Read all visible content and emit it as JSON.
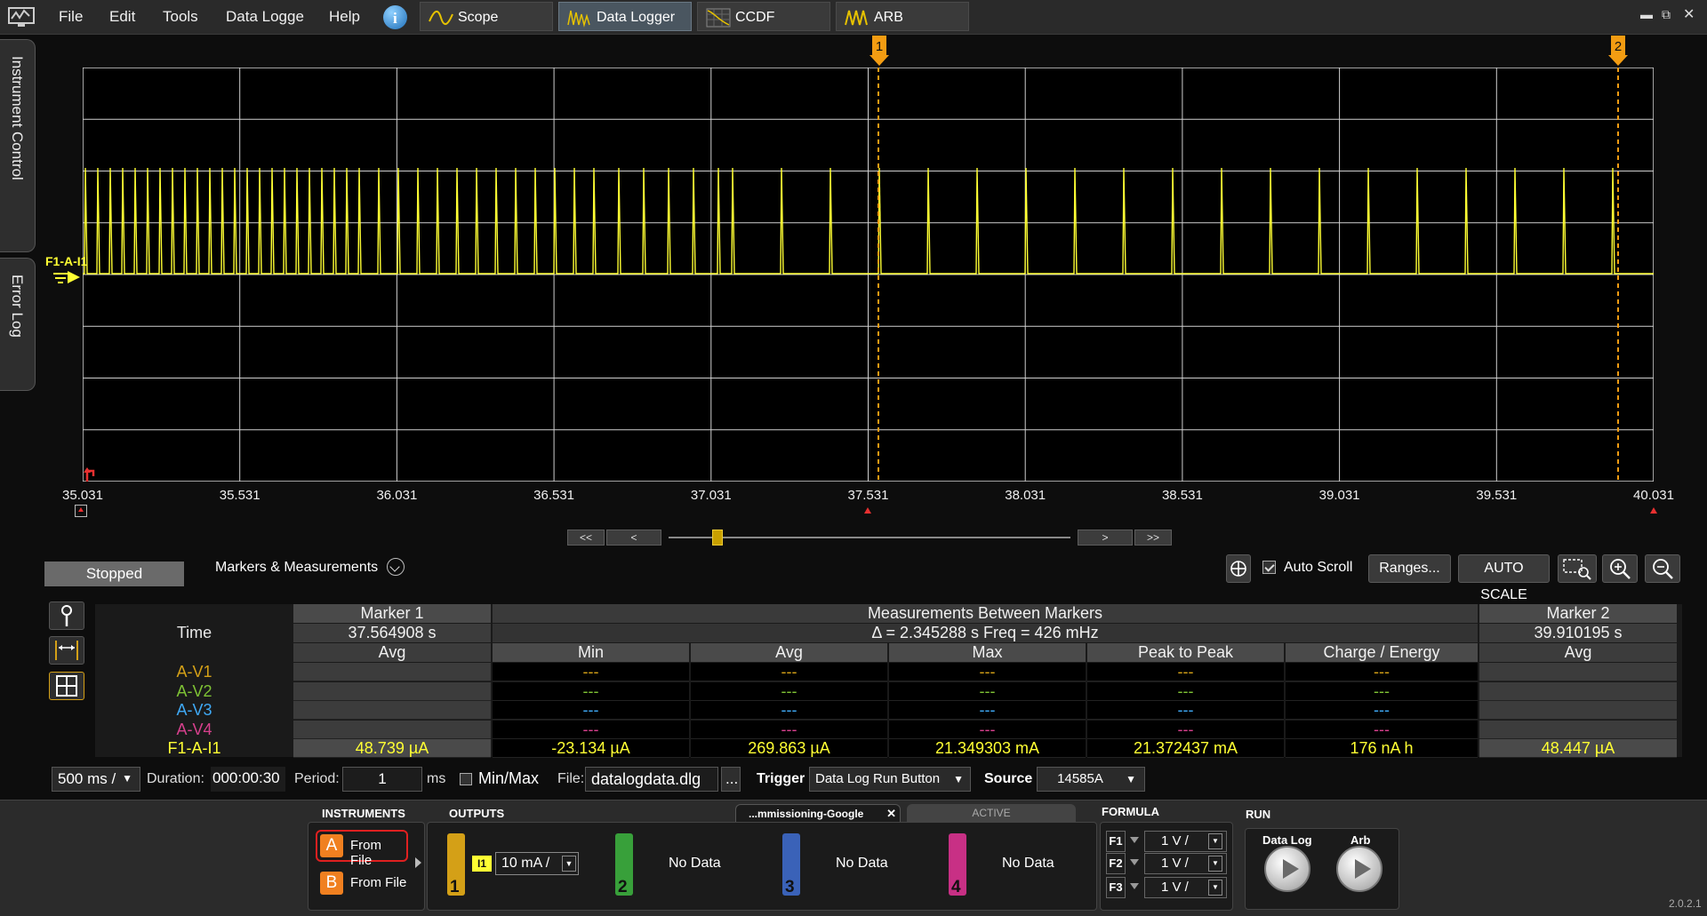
{
  "menu": {
    "file": "File",
    "edit": "Edit",
    "tools": "Tools",
    "data_logger": "Data Logge",
    "help": "Help"
  },
  "tabs": [
    {
      "label": "Scope",
      "active": false
    },
    {
      "label": "Data Logger",
      "active": true
    },
    {
      "label": "CCDF",
      "active": false
    },
    {
      "label": "ARB",
      "active": false
    }
  ],
  "side_tabs": {
    "instrument_control": "Instrument Control",
    "error_log": "Error Log"
  },
  "plot": {
    "trace_label": "F1-A-I1",
    "trace_color": "#ffff33",
    "marker_color": "#f39c12",
    "x_ticks": [
      "35.031",
      "35.531",
      "36.031",
      "36.531",
      "37.031",
      "37.531",
      "38.031",
      "38.531",
      "39.031",
      "39.531",
      "40.031"
    ],
    "marker1_label": "1",
    "marker2_label": "2"
  },
  "nav": {
    "first": "<<",
    "prev": "<",
    "next": ">",
    "last": ">>"
  },
  "toolbar": {
    "status": "Stopped",
    "markers_measurements": "Markers & Measurements",
    "auto_scroll": "Auto Scroll",
    "auto_scroll_checked": true,
    "ranges": "Ranges...",
    "auto_scale": "AUTO SCALE"
  },
  "measurements": {
    "time_label": "Time",
    "marker1_title": "Marker 1",
    "marker1_time": "37.564908 s",
    "between_title": "Measurements Between Markers",
    "between_info": "Δ = 2.345288 s   Freq = 426 mHz",
    "marker2_title": "Marker 2",
    "marker2_time": "39.910195 s",
    "columns": {
      "m1_avg": "Avg",
      "min": "Min",
      "avg": "Avg",
      "max": "Max",
      "p2p": "Peak to Peak",
      "charge": "Charge / Energy",
      "m2_avg": "Avg"
    },
    "rows": [
      {
        "label": "A-V1",
        "color": "#d4a017",
        "m1": "",
        "min": "---",
        "avg": "---",
        "max": "---",
        "p2p": "---",
        "charge": "---",
        "m2": ""
      },
      {
        "label": "A-V2",
        "color": "#7ec234",
        "m1": "",
        "min": "---",
        "avg": "---",
        "max": "---",
        "p2p": "---",
        "charge": "---",
        "m2": ""
      },
      {
        "label": "A-V3",
        "color": "#3fa9f5",
        "m1": "",
        "min": "---",
        "avg": "---",
        "max": "---",
        "p2p": "---",
        "charge": "---",
        "m2": ""
      },
      {
        "label": "A-V4",
        "color": "#d6408c",
        "m1": "",
        "min": "---",
        "avg": "---",
        "max": "---",
        "p2p": "---",
        "charge": "---",
        "m2": ""
      },
      {
        "label": "F1-A-I1",
        "color": "#ffff33",
        "m1": "48.739 µA",
        "min": "-23.134 µA",
        "avg": "269.863 µA",
        "max": "21.349303 mA",
        "p2p": "21.372437 mA",
        "charge": "176 nA h",
        "m2": "48.447 µA"
      }
    ]
  },
  "settings": {
    "timebase": "500 ms /",
    "duration_label": "Duration:",
    "duration": "000:00:30",
    "period_label": "Period:",
    "period": "1",
    "period_unit": "ms",
    "minmax": "Min/Max",
    "minmax_checked": false,
    "file_label": "File:",
    "file": "datalogdata.dlg",
    "file_btn": "...",
    "trigger_label": "Trigger",
    "trigger": "Data Log Run Button",
    "source_label": "Source",
    "source": "14585A"
  },
  "bottom": {
    "instruments_label": "INSTRUMENTS",
    "outputs_label": "OUTPUTS",
    "inst_a_letter": "A",
    "inst_a": "From File",
    "inst_b_letter": "B",
    "inst_b": "From File",
    "ch1_tag": "I1",
    "ch1_range": "10 mA /",
    "ch1_num": "1",
    "ch2_num": "2",
    "ch3_num": "3",
    "ch4_num": "4",
    "ch2_text": "No Data",
    "ch3_text": "No Data",
    "ch4_text": "No Data",
    "session_tab": "...mmissioning-Google",
    "active_tab": "ACTIVE",
    "formula_label": "FORMULA",
    "f1": "F1",
    "f1_val": "1 V /",
    "f2": "F2",
    "f2_val": "1 V /",
    "f3": "F3",
    "f3_val": "1 V /",
    "run_label": "RUN",
    "run_datalog": "Data Log",
    "run_arb": "Arb",
    "version": "2.0.2.1"
  }
}
